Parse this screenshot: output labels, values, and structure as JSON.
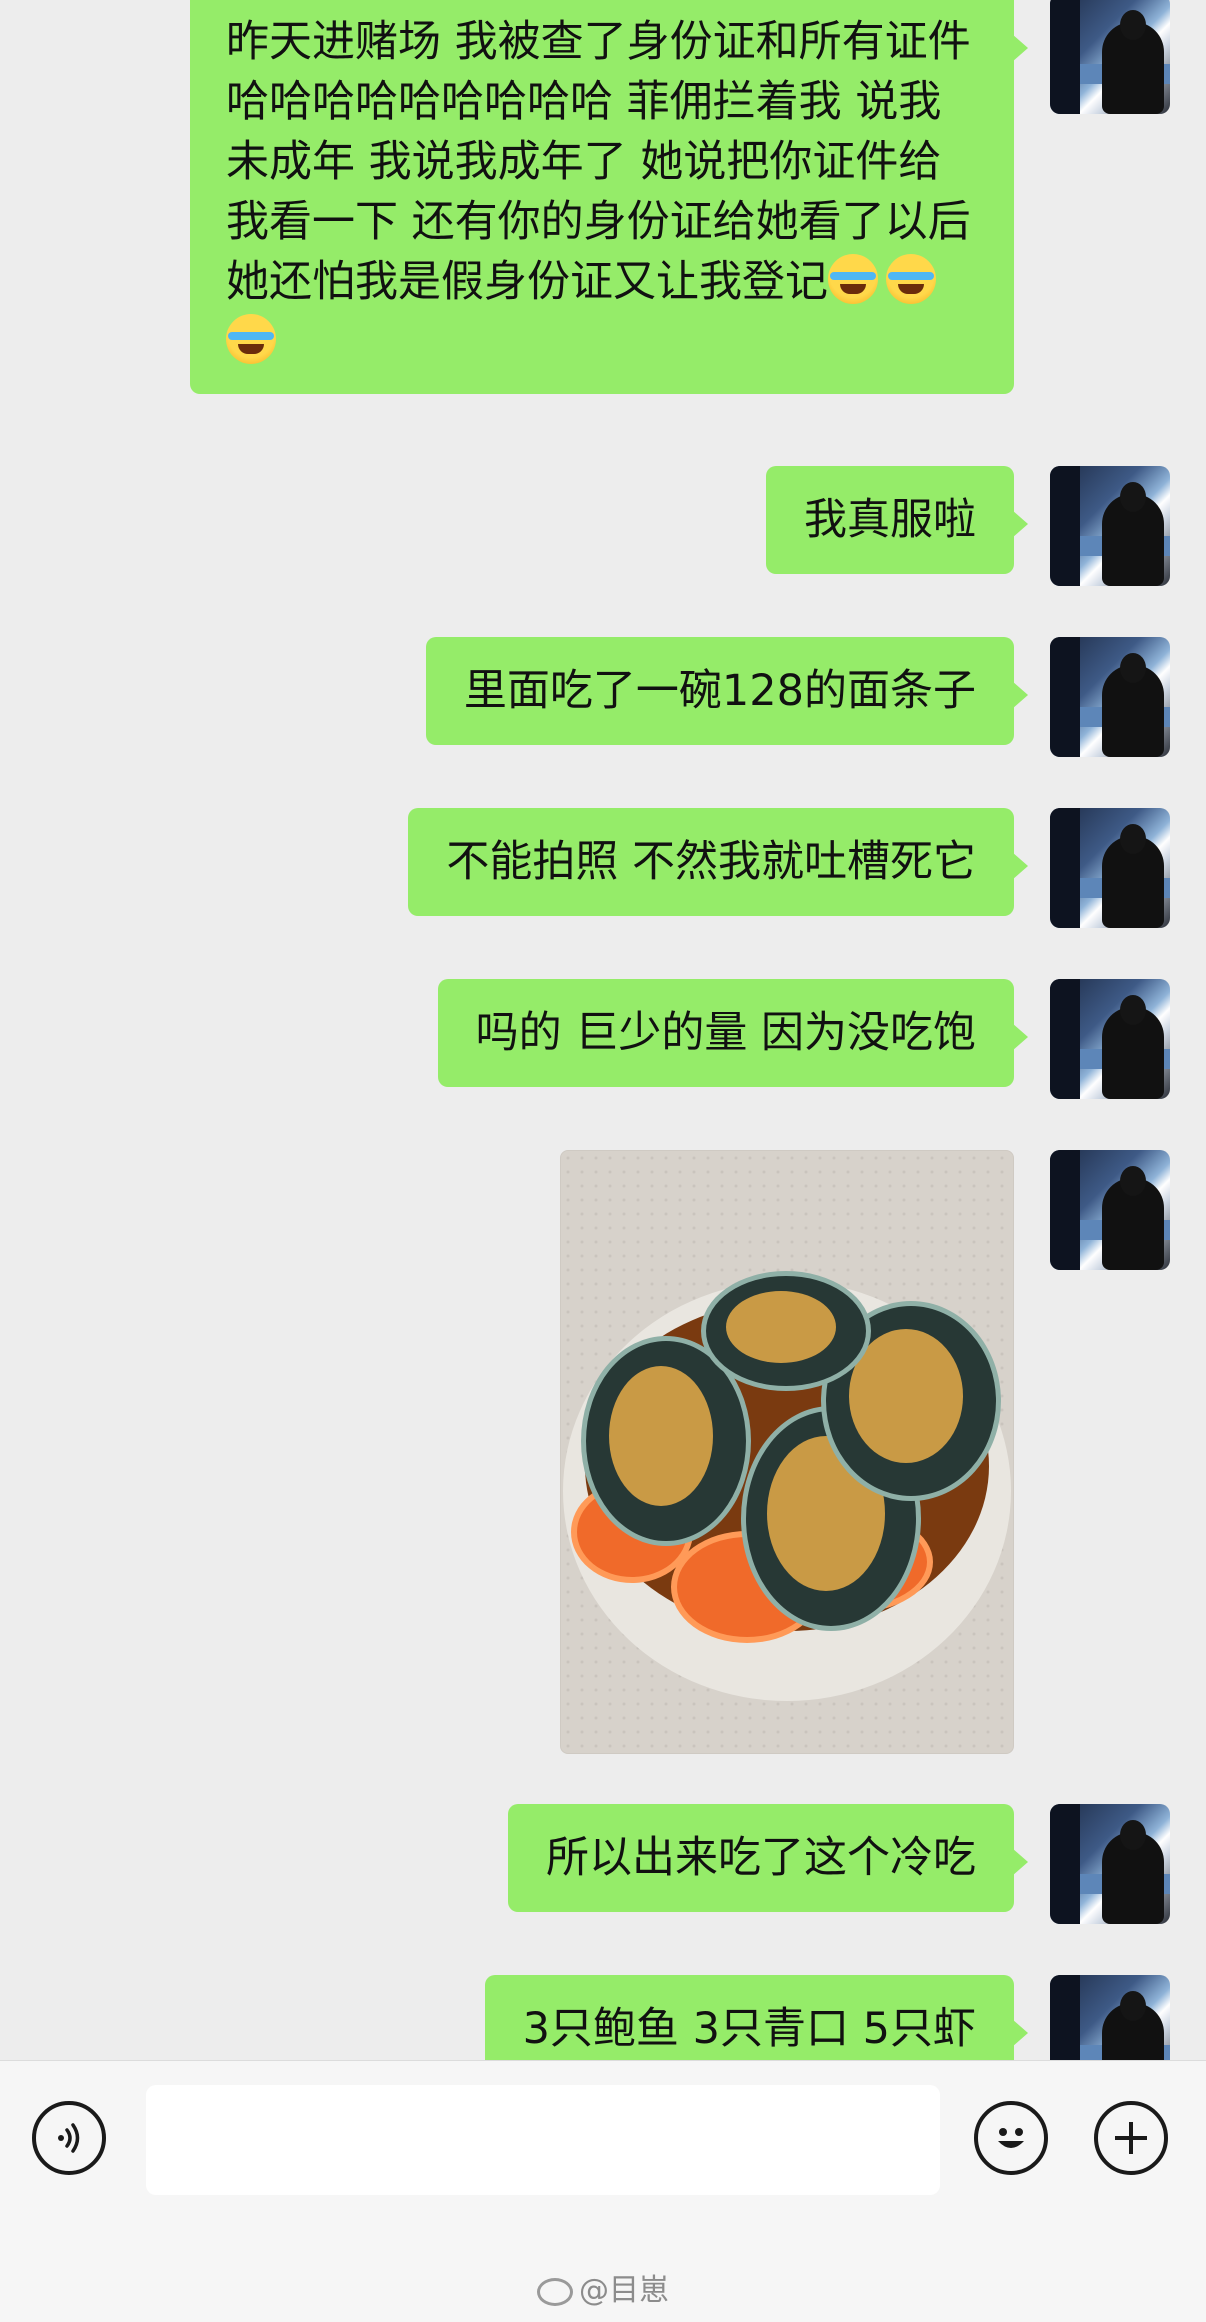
{
  "messages": [
    {
      "type": "text",
      "text": "昨天进赌场 我被查了身份证和所有证件 哈哈哈哈哈哈哈哈哈 菲佣拦着我 说我未成年 我说我成年了 她说把你证件给我看一下 还有你的身份证给她看了以后她还怕我是假身份证又让我登记"
    },
    {
      "type": "text",
      "text": "我真服啦"
    },
    {
      "type": "text",
      "text": "里面吃了一碗128的面条子"
    },
    {
      "type": "text",
      "text": "不能拍照 不然我就吐槽死它"
    },
    {
      "type": "text",
      "text": "吗的 巨少的量 因为没吃饱"
    },
    {
      "type": "image",
      "alt": "seafood-bowl"
    },
    {
      "type": "text",
      "text": "所以出来吃了这个冷吃"
    },
    {
      "type": "text",
      "text": "3只鲍鱼 3只青口 5只虾"
    }
  ],
  "message_emojis": [
    "crying-laughing-emoji",
    "crying-laughing-emoji",
    "crying-laughing-emoji"
  ],
  "input": {
    "value": "",
    "placeholder": ""
  },
  "icons": {
    "voice": "voice-icon",
    "emoji": "smiley-icon",
    "more": "plus-icon"
  },
  "watermark": {
    "text": "@目崽"
  },
  "colors": {
    "bubble": "#95ec69",
    "background": "#ededed",
    "bar": "#f6f6f6"
  }
}
